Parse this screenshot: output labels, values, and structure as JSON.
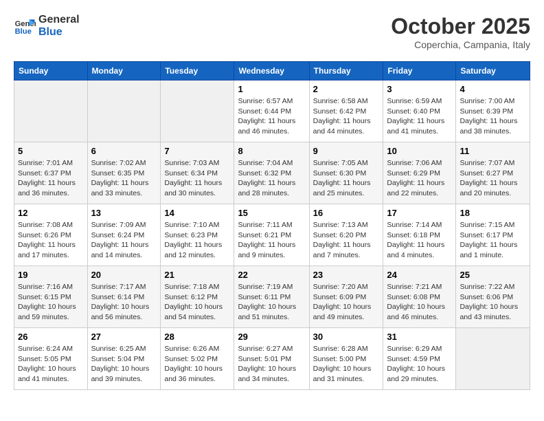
{
  "header": {
    "logo_line1": "General",
    "logo_line2": "Blue",
    "month": "October 2025",
    "location": "Coperchia, Campania, Italy"
  },
  "days_of_week": [
    "Sunday",
    "Monday",
    "Tuesday",
    "Wednesday",
    "Thursday",
    "Friday",
    "Saturday"
  ],
  "weeks": [
    [
      {
        "day": "",
        "info": ""
      },
      {
        "day": "",
        "info": ""
      },
      {
        "day": "",
        "info": ""
      },
      {
        "day": "1",
        "info": "Sunrise: 6:57 AM\nSunset: 6:44 PM\nDaylight: 11 hours and 46 minutes."
      },
      {
        "day": "2",
        "info": "Sunrise: 6:58 AM\nSunset: 6:42 PM\nDaylight: 11 hours and 44 minutes."
      },
      {
        "day": "3",
        "info": "Sunrise: 6:59 AM\nSunset: 6:40 PM\nDaylight: 11 hours and 41 minutes."
      },
      {
        "day": "4",
        "info": "Sunrise: 7:00 AM\nSunset: 6:39 PM\nDaylight: 11 hours and 38 minutes."
      }
    ],
    [
      {
        "day": "5",
        "info": "Sunrise: 7:01 AM\nSunset: 6:37 PM\nDaylight: 11 hours and 36 minutes."
      },
      {
        "day": "6",
        "info": "Sunrise: 7:02 AM\nSunset: 6:35 PM\nDaylight: 11 hours and 33 minutes."
      },
      {
        "day": "7",
        "info": "Sunrise: 7:03 AM\nSunset: 6:34 PM\nDaylight: 11 hours and 30 minutes."
      },
      {
        "day": "8",
        "info": "Sunrise: 7:04 AM\nSunset: 6:32 PM\nDaylight: 11 hours and 28 minutes."
      },
      {
        "day": "9",
        "info": "Sunrise: 7:05 AM\nSunset: 6:30 PM\nDaylight: 11 hours and 25 minutes."
      },
      {
        "day": "10",
        "info": "Sunrise: 7:06 AM\nSunset: 6:29 PM\nDaylight: 11 hours and 22 minutes."
      },
      {
        "day": "11",
        "info": "Sunrise: 7:07 AM\nSunset: 6:27 PM\nDaylight: 11 hours and 20 minutes."
      }
    ],
    [
      {
        "day": "12",
        "info": "Sunrise: 7:08 AM\nSunset: 6:26 PM\nDaylight: 11 hours and 17 minutes."
      },
      {
        "day": "13",
        "info": "Sunrise: 7:09 AM\nSunset: 6:24 PM\nDaylight: 11 hours and 14 minutes."
      },
      {
        "day": "14",
        "info": "Sunrise: 7:10 AM\nSunset: 6:23 PM\nDaylight: 11 hours and 12 minutes."
      },
      {
        "day": "15",
        "info": "Sunrise: 7:11 AM\nSunset: 6:21 PM\nDaylight: 11 hours and 9 minutes."
      },
      {
        "day": "16",
        "info": "Sunrise: 7:13 AM\nSunset: 6:20 PM\nDaylight: 11 hours and 7 minutes."
      },
      {
        "day": "17",
        "info": "Sunrise: 7:14 AM\nSunset: 6:18 PM\nDaylight: 11 hours and 4 minutes."
      },
      {
        "day": "18",
        "info": "Sunrise: 7:15 AM\nSunset: 6:17 PM\nDaylight: 11 hours and 1 minute."
      }
    ],
    [
      {
        "day": "19",
        "info": "Sunrise: 7:16 AM\nSunset: 6:15 PM\nDaylight: 10 hours and 59 minutes."
      },
      {
        "day": "20",
        "info": "Sunrise: 7:17 AM\nSunset: 6:14 PM\nDaylight: 10 hours and 56 minutes."
      },
      {
        "day": "21",
        "info": "Sunrise: 7:18 AM\nSunset: 6:12 PM\nDaylight: 10 hours and 54 minutes."
      },
      {
        "day": "22",
        "info": "Sunrise: 7:19 AM\nSunset: 6:11 PM\nDaylight: 10 hours and 51 minutes."
      },
      {
        "day": "23",
        "info": "Sunrise: 7:20 AM\nSunset: 6:09 PM\nDaylight: 10 hours and 49 minutes."
      },
      {
        "day": "24",
        "info": "Sunrise: 7:21 AM\nSunset: 6:08 PM\nDaylight: 10 hours and 46 minutes."
      },
      {
        "day": "25",
        "info": "Sunrise: 7:22 AM\nSunset: 6:06 PM\nDaylight: 10 hours and 43 minutes."
      }
    ],
    [
      {
        "day": "26",
        "info": "Sunrise: 6:24 AM\nSunset: 5:05 PM\nDaylight: 10 hours and 41 minutes."
      },
      {
        "day": "27",
        "info": "Sunrise: 6:25 AM\nSunset: 5:04 PM\nDaylight: 10 hours and 39 minutes."
      },
      {
        "day": "28",
        "info": "Sunrise: 6:26 AM\nSunset: 5:02 PM\nDaylight: 10 hours and 36 minutes."
      },
      {
        "day": "29",
        "info": "Sunrise: 6:27 AM\nSunset: 5:01 PM\nDaylight: 10 hours and 34 minutes."
      },
      {
        "day": "30",
        "info": "Sunrise: 6:28 AM\nSunset: 5:00 PM\nDaylight: 10 hours and 31 minutes."
      },
      {
        "day": "31",
        "info": "Sunrise: 6:29 AM\nSunset: 4:59 PM\nDaylight: 10 hours and 29 minutes."
      },
      {
        "day": "",
        "info": ""
      }
    ]
  ]
}
